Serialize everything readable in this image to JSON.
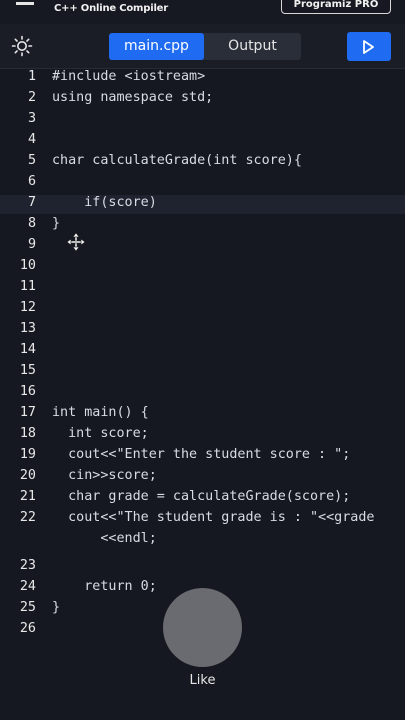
{
  "header": {
    "app_title": "C++ Online Compiler",
    "pro_label": "Programiz PRO"
  },
  "toolbar": {
    "theme_icon": "sun-icon",
    "tabs": [
      "main.cpp",
      "Output"
    ],
    "active_tab": "main.cpp",
    "run_icon": "play-icon",
    "accent_color": "#1f6bf2"
  },
  "editor": {
    "line_numbers": [
      "1",
      "2",
      "3",
      "4",
      "5",
      "6",
      "7",
      "8",
      "9",
      "10",
      "11",
      "12",
      "13",
      "14",
      "15",
      "16",
      "17",
      "18",
      "19",
      "20",
      "21",
      "22",
      "",
      "23",
      "24",
      "25",
      "26"
    ],
    "lines": [
      "#include <iostream>",
      "using namespace std;",
      "",
      "",
      "char calculateGrade(int score){",
      "",
      "    if(score)",
      "}",
      "",
      "",
      "",
      "",
      "",
      "",
      "",
      "",
      "int main() {",
      "  int score;",
      "  cout<<\"Enter the student score : \";",
      "  cin>>score;",
      "  char grade = calculateGrade(score);",
      "  cout<<\"The student grade is : \"<<grade",
      "      <<endl;",
      "",
      "    return 0;",
      "}",
      ""
    ]
  },
  "overlay": {
    "like_label": "Like"
  }
}
